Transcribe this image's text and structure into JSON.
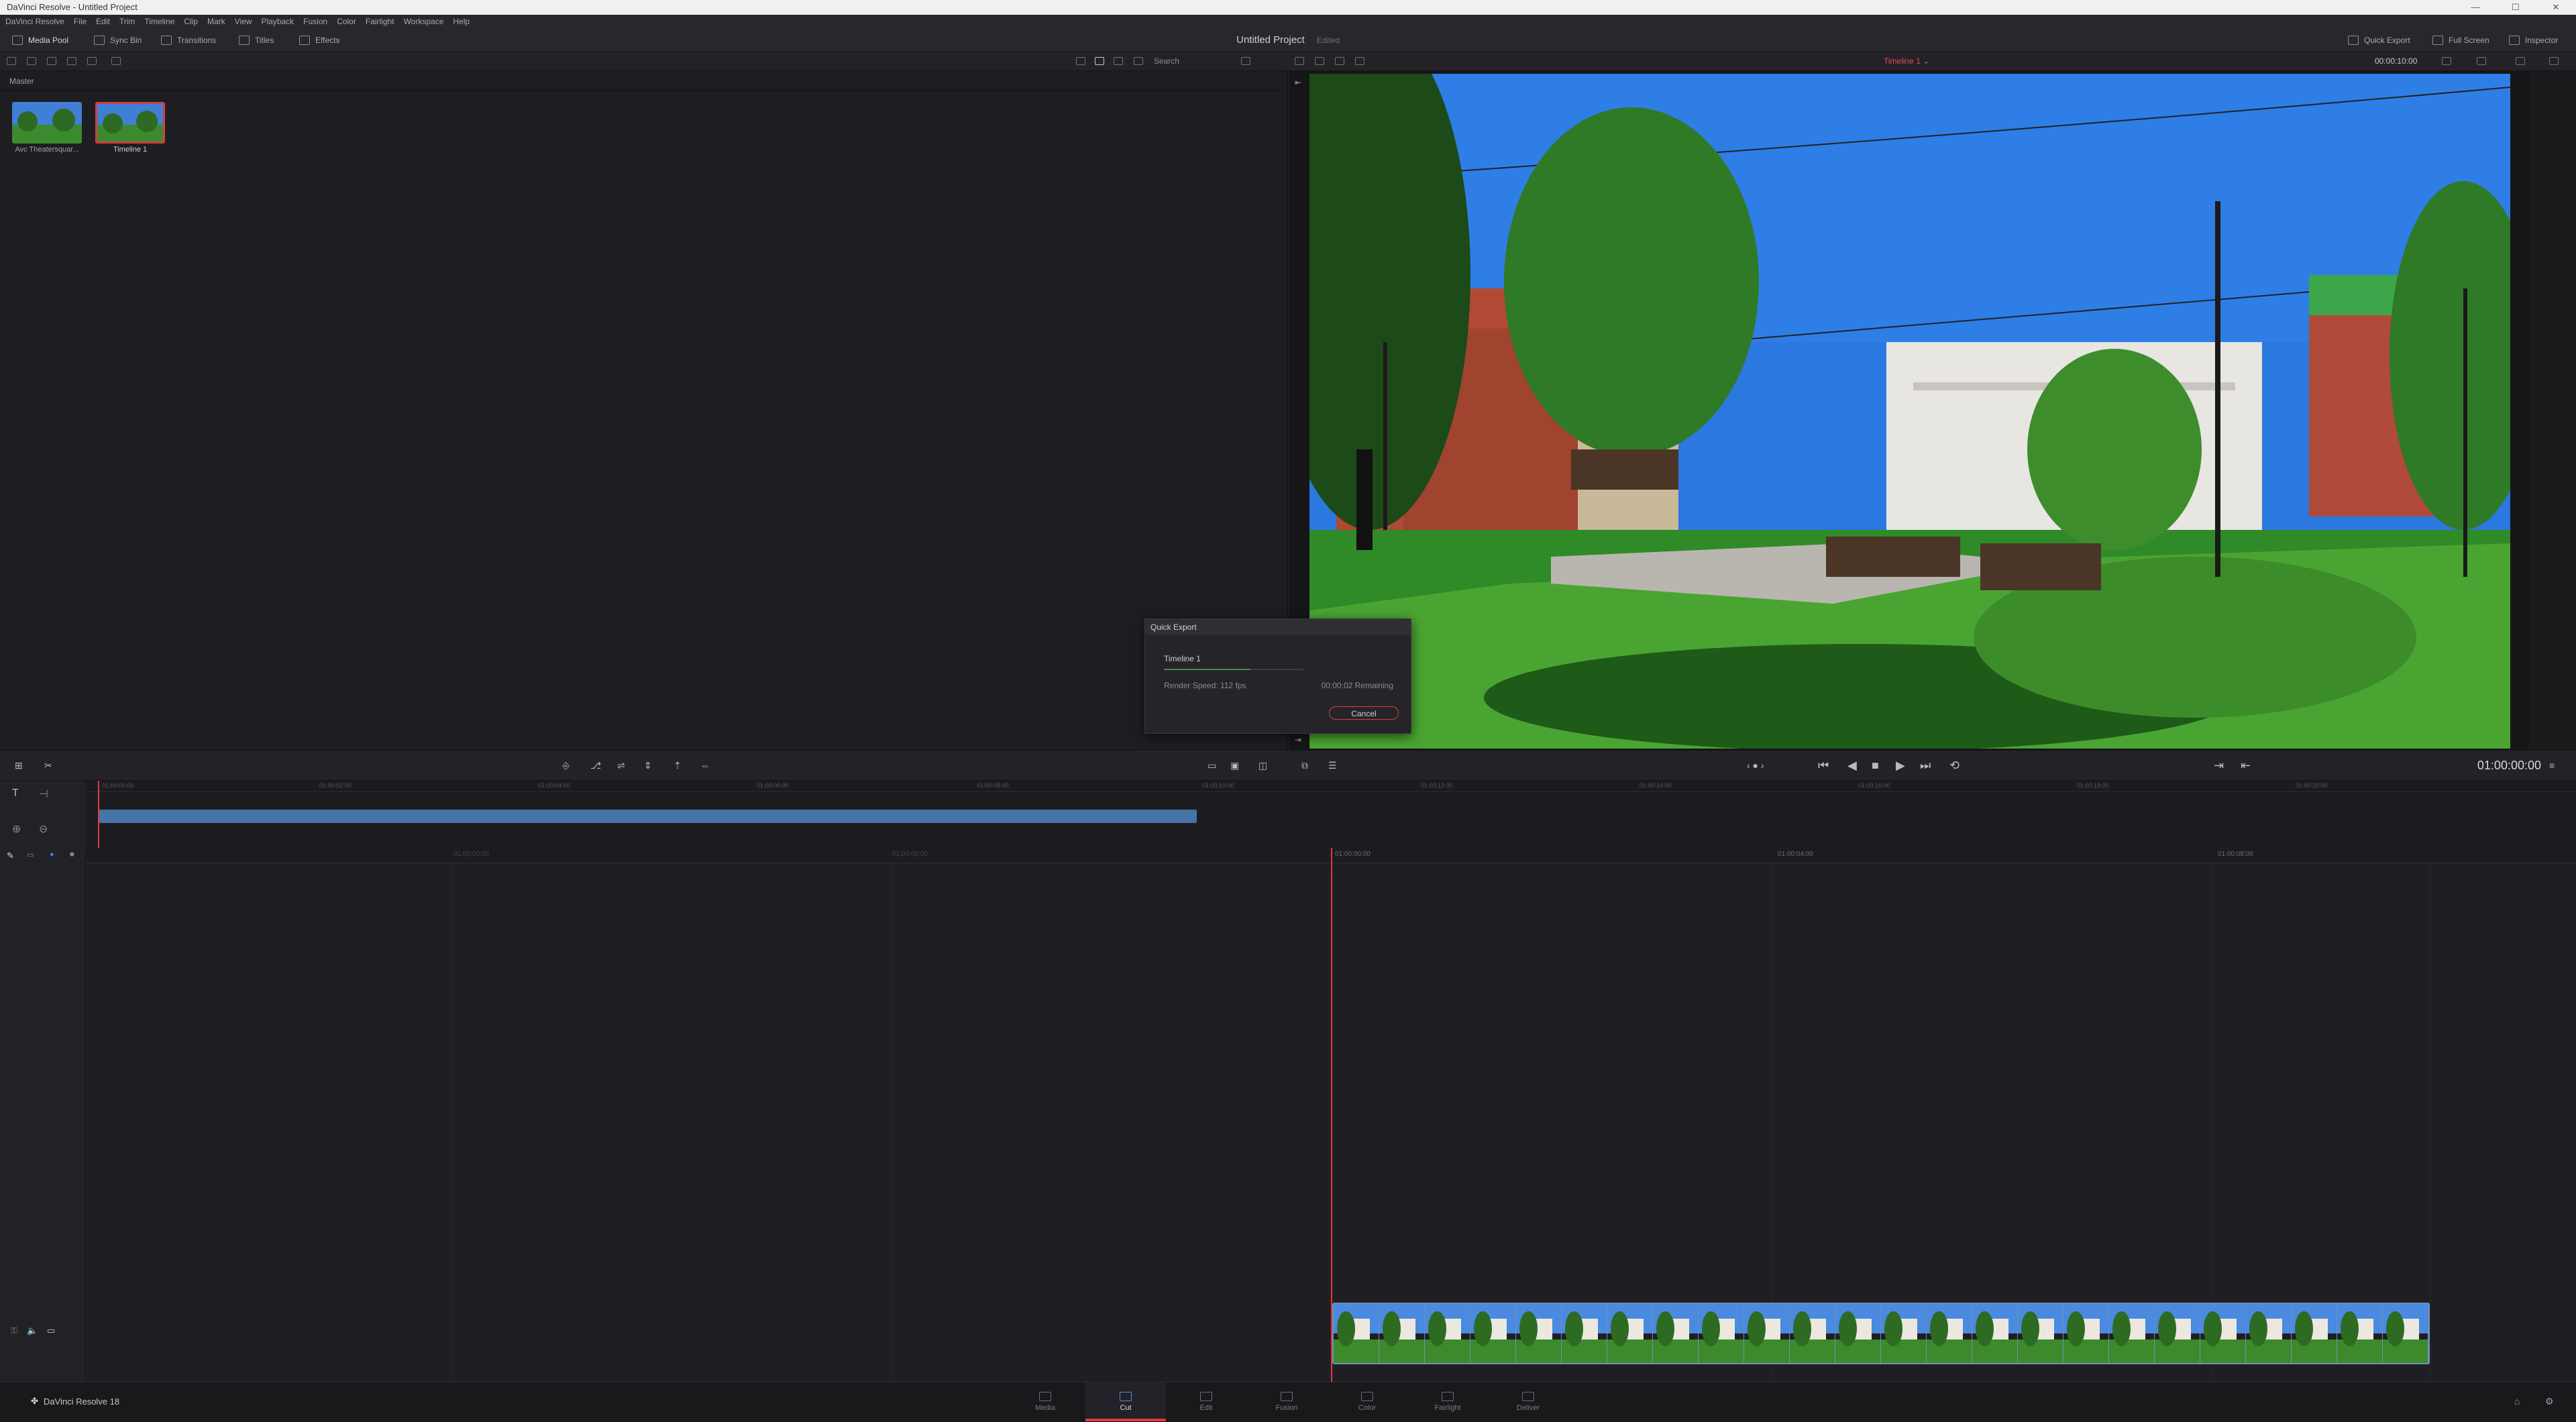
{
  "window": {
    "title": "DaVinci Resolve - Untitled Project",
    "controls": [
      "—",
      "☐",
      "✕"
    ]
  },
  "menu": [
    "DaVinci Resolve",
    "File",
    "Edit",
    "Trim",
    "Timeline",
    "Clip",
    "Mark",
    "View",
    "Playback",
    "Fusion",
    "Color",
    "Fairlight",
    "Workspace",
    "Help"
  ],
  "toolbar": {
    "media_pool": "Media Pool",
    "sync_bin": "Sync Bin",
    "transitions": "Transitions",
    "titles": "Titles",
    "effects": "Effects",
    "project_title": "Untitled Project",
    "project_status": "Edited",
    "quick_export": "Quick Export",
    "full_screen": "Full Screen",
    "inspector": "Inspector"
  },
  "subbar": {
    "search_placeholder": "Search",
    "timeline_selector": "Timeline 1 ⌄",
    "viewer_timecode": "00:00:10:00"
  },
  "media_pool": {
    "bin": "Master",
    "clips": [
      {
        "name": "Avc Theatersquar...",
        "selected": false
      },
      {
        "name": "Timeline 1",
        "selected": true
      }
    ]
  },
  "quick_export": {
    "title": "Quick Export",
    "timeline": "Timeline 1",
    "progress": 0.62,
    "render_speed": "Render Speed: 112 fps",
    "remaining": "00:00:02 Remaining",
    "cancel": "Cancel"
  },
  "transport": {
    "timecode": "01:00:00:00"
  },
  "upper_ruler": [
    "01:00:00:00",
    "01:00:02:00",
    "01:00:04:00",
    "01:00:06:00",
    "01:00:08:00",
    "01:00:10:00",
    "01:00:12:00",
    "01:00:14:00",
    "01:00:16:00",
    "01:00:18:00",
    "01:00:20:00"
  ],
  "lower_ruler": [
    "01:00:00:00",
    "01:00:00:00",
    "01:00:00:00",
    "01:00:04:00",
    "01:00:08:00"
  ],
  "pages": [
    {
      "label": "Media",
      "active": false
    },
    {
      "label": "Cut",
      "active": true
    },
    {
      "label": "Edit",
      "active": false
    },
    {
      "label": "Fusion",
      "active": false
    },
    {
      "label": "Color",
      "active": false
    },
    {
      "label": "Fairlight",
      "active": false
    },
    {
      "label": "Deliver",
      "active": false
    }
  ],
  "brand": "DaVinci Resolve 18",
  "colors": {
    "playhead": "#e03a3a",
    "clip": "#4773a6",
    "progress": "#3f8f45"
  }
}
